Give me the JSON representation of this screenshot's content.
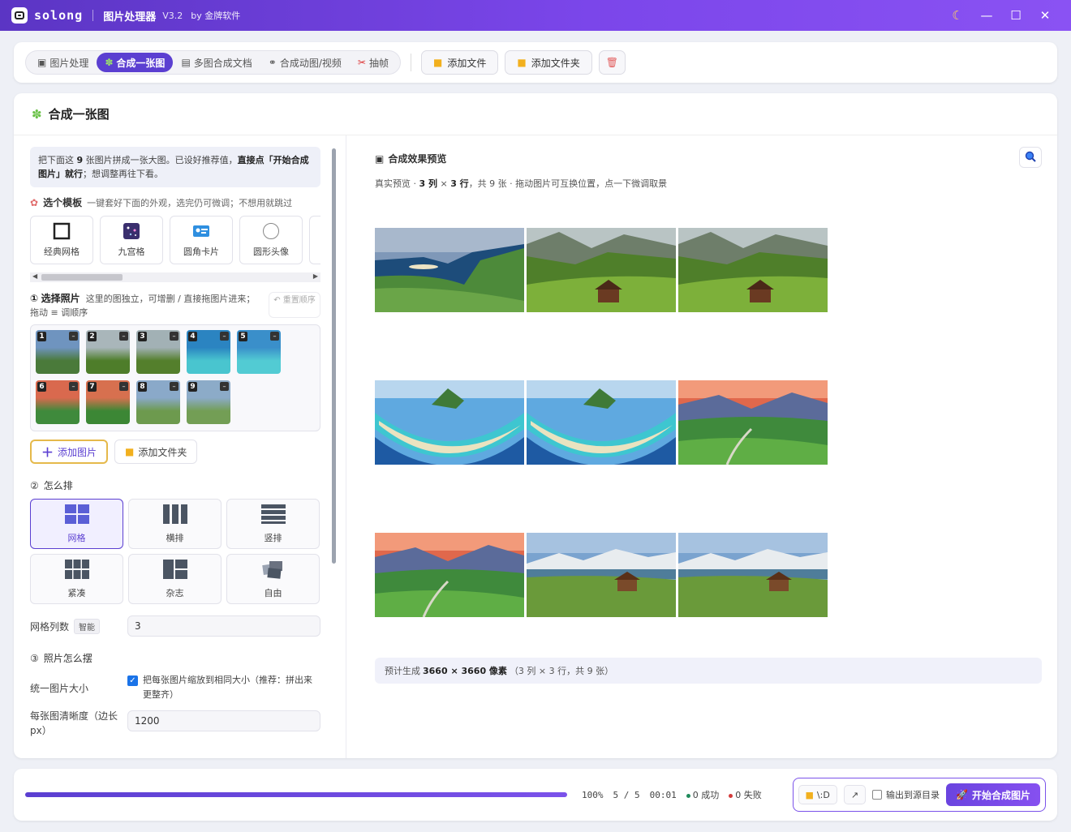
{
  "titlebar": {
    "app_name": "solong",
    "product": "图片处理器",
    "version": "V3.2",
    "by": "by 金牌软件"
  },
  "toolbar": {
    "tabs": [
      {
        "label": "图片处理",
        "icon": "image-icon"
      },
      {
        "label": "合成一张图",
        "icon": "puzzle-icon"
      },
      {
        "label": "多图合成文档",
        "icon": "document-icon"
      },
      {
        "label": "合成动图/视频",
        "icon": "link-icon"
      },
      {
        "label": "抽帧",
        "icon": "scissors-icon"
      }
    ],
    "active_tab": 1,
    "add_file": "添加文件",
    "add_folder": "添加文件夹"
  },
  "main": {
    "title": "合成一张图",
    "tip": {
      "p1": "把下面这 ",
      "count": "9",
      "p2": " 张图片拼成一张大图。已设好推荐值，",
      "strong": "直接点「开始合成图片」就行",
      "p3": "；想调整再往下看。"
    },
    "template_section": {
      "title": "选个模板",
      "hint": "一键套好下面的外观，选完仍可微调；不想用就跳过"
    },
    "templates": [
      {
        "label": "经典网格",
        "icon": "square-icon"
      },
      {
        "label": "九宫格",
        "icon": "galaxy-icon"
      },
      {
        "label": "圆角卡片",
        "icon": "id-card-icon"
      },
      {
        "label": "圆形头像",
        "icon": "circle-icon"
      }
    ],
    "photos_section": {
      "number": "①",
      "title": "选择照片",
      "hint": "这里的图独立，可增删 / 直接拖图片进来；拖动 ≡ 调顺序",
      "reset": "↶ 重置顺序"
    },
    "photos": [
      {
        "n": "1",
        "colors": [
          "#6f94bf",
          "#4a7a3a"
        ]
      },
      {
        "n": "2",
        "colors": [
          "#a9b6ba",
          "#4e7d2a"
        ]
      },
      {
        "n": "3",
        "colors": [
          "#a2b1b5",
          "#547f2c"
        ]
      },
      {
        "n": "4",
        "colors": [
          "#2b84c1",
          "#49c5cf"
        ]
      },
      {
        "n": "5",
        "colors": [
          "#3a8fca",
          "#52cbd3"
        ]
      },
      {
        "n": "6",
        "colors": [
          "#d9694e",
          "#3f8a3c"
        ]
      },
      {
        "n": "7",
        "colors": [
          "#d7704f",
          "#3c8735"
        ]
      },
      {
        "n": "8",
        "colors": [
          "#8aa9c9",
          "#6d9a4e"
        ]
      },
      {
        "n": "9",
        "colors": [
          "#8cabc8",
          "#739e55"
        ]
      }
    ],
    "add_image": "添加图片",
    "add_folder": "添加文件夹",
    "layout_section": {
      "number": "②",
      "title": "怎么排"
    },
    "layouts": [
      {
        "label": "网格",
        "icon": "grid-icon"
      },
      {
        "label": "横排",
        "icon": "columns-icon"
      },
      {
        "label": "竖排",
        "icon": "rows-icon"
      },
      {
        "label": "紧凑",
        "icon": "compact-icon"
      },
      {
        "label": "杂志",
        "icon": "magazine-icon"
      },
      {
        "label": "自由",
        "icon": "free-icon"
      }
    ],
    "active_layout": 0,
    "grid_cols_label": "网格列数",
    "smart_chip": "智能",
    "grid_cols_value": "3",
    "arrange_section": {
      "number": "③",
      "title": "照片怎么摆"
    },
    "unify_label": "统一图片大小",
    "unify_text": "把每张图片缩放到相同大小（推荐：拼出来更整齐）",
    "unify_checked": true,
    "clarity_label": "每张图清晰度（边长 px）",
    "clarity_value": "1200"
  },
  "preview": {
    "title": "合成效果预览",
    "subtitle": {
      "p1": "真实预览 · ",
      "cols": "3 列",
      "x": " × ",
      "rows": "3 行",
      "p2": "，共 9 张 · 拖动图片可互换位置，点一下微调取景"
    },
    "images": [
      [
        "coast",
        "valley",
        "valley"
      ],
      [
        "atoll",
        "atoll",
        "sunset"
      ],
      [
        "sunset",
        "meadow",
        "meadow"
      ]
    ],
    "estimate": {
      "p1": "预计生成",
      "size": "3660 × 3660 像素",
      "p2": "（3 列 × 3 行，共 9 张）"
    }
  },
  "status": {
    "progress_percent": 100,
    "percent_text": "100%",
    "count_text": "5 / 5",
    "time_text": "00:01",
    "success_text": "0 成功",
    "fail_text": "0 失败",
    "path_text": "\\:D",
    "output_source": "输出到源目录",
    "start": "开始合成图片",
    "colors": {
      "accent": "#5b3fd1",
      "success": "#1f8a5b",
      "fail": "#d43b3b"
    }
  }
}
